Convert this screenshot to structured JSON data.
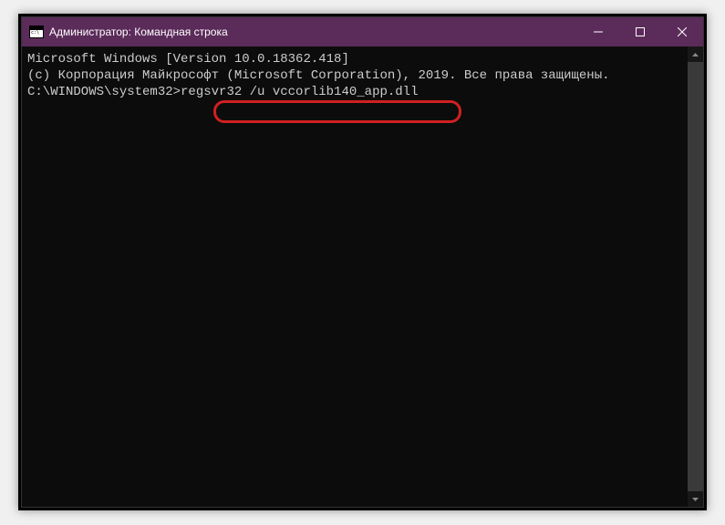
{
  "window": {
    "title": "Администратор: Командная строка"
  },
  "terminal": {
    "line1": "Microsoft Windows [Version 10.0.18362.418]",
    "line2": "(c) Корпорация Майкрософт (Microsoft Corporation), 2019. Все права защищены.",
    "blank": "",
    "prompt": "C:\\WINDOWS\\system32>",
    "command": "regsvr32 /u vccorlib140_app.dll"
  }
}
